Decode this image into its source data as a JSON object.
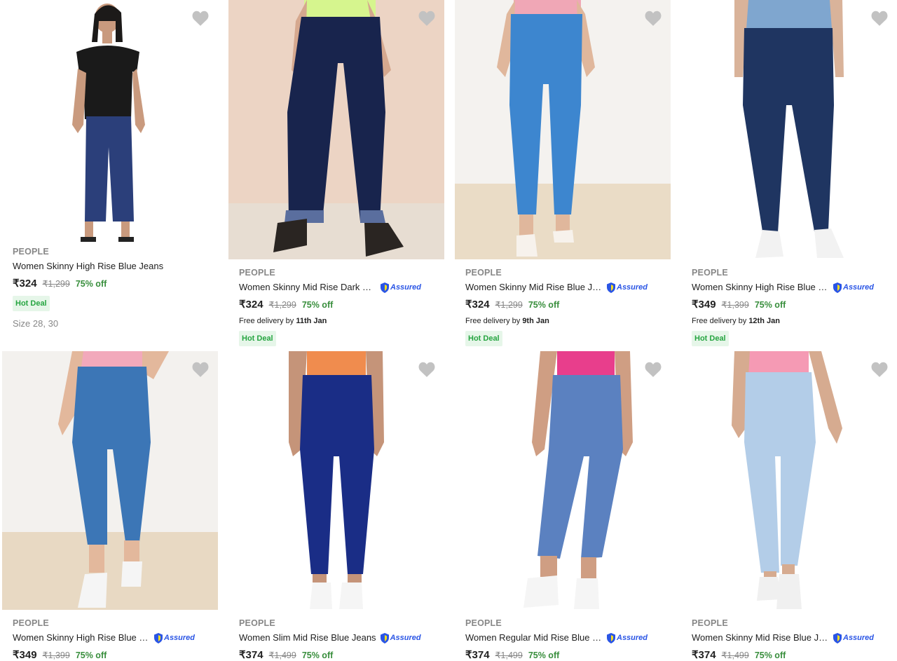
{
  "colors": {
    "brand": "#878787",
    "discount": "#388e3c",
    "hot_deal_bg": "#e6f6e9",
    "hot_deal_text": "#26a541",
    "assured": "#2a55e5",
    "wishlist_icon": "#c2c2c2"
  },
  "products": [
    {
      "brand": "PEOPLE",
      "title": "Women Skinny High Rise Blue Jeans",
      "price": "₹324",
      "mrp": "₹1,299",
      "discount": "75% off",
      "hot_deal": "Hot Deal",
      "size": "Size 28, 30",
      "assured": false
    },
    {
      "brand": "PEOPLE",
      "title": "Women Skinny Mid Rise Dark Bl...",
      "assured_label": "Assured",
      "price": "₹324",
      "mrp": "₹1,299",
      "discount": "75% off",
      "delivery_prefix": "Free delivery by ",
      "delivery_date": "11th Jan",
      "hot_deal": "Hot Deal",
      "assured": true
    },
    {
      "brand": "PEOPLE",
      "title": "Women Skinny Mid Rise Blue Je...",
      "assured_label": "Assured",
      "price": "₹324",
      "mrp": "₹1,299",
      "discount": "75% off",
      "delivery_prefix": "Free delivery by ",
      "delivery_date": "9th Jan",
      "hot_deal": "Hot Deal",
      "assured": true
    },
    {
      "brand": "PEOPLE",
      "title": "Women Skinny High Rise Blue J...",
      "assured_label": "Assured",
      "price": "₹349",
      "mrp": "₹1,399",
      "discount": "75% off",
      "delivery_prefix": "Free delivery by ",
      "delivery_date": "12th Jan",
      "hot_deal": "Hot Deal",
      "assured": true
    },
    {
      "brand": "PEOPLE",
      "title": "Women Skinny High Rise Blue J...",
      "assured_label": "Assured",
      "price": "₹349",
      "mrp": "₹1,399",
      "discount": "75% off",
      "assured": true
    },
    {
      "brand": "PEOPLE",
      "title": "Women Slim Mid Rise Blue Jeans",
      "assured_label": "Assured",
      "price": "₹374",
      "mrp": "₹1,499",
      "discount": "75% off",
      "assured": true
    },
    {
      "brand": "PEOPLE",
      "title": "Women Regular Mid Rise Blue J...",
      "assured_label": "Assured",
      "price": "₹374",
      "mrp": "₹1,499",
      "discount": "75% off",
      "assured": true
    },
    {
      "brand": "PEOPLE",
      "title": "Women Skinny Mid Rise Blue Je...",
      "assured_label": "Assured",
      "price": "₹374",
      "mrp": "₹1,499",
      "discount": "75% off",
      "assured": true
    }
  ]
}
